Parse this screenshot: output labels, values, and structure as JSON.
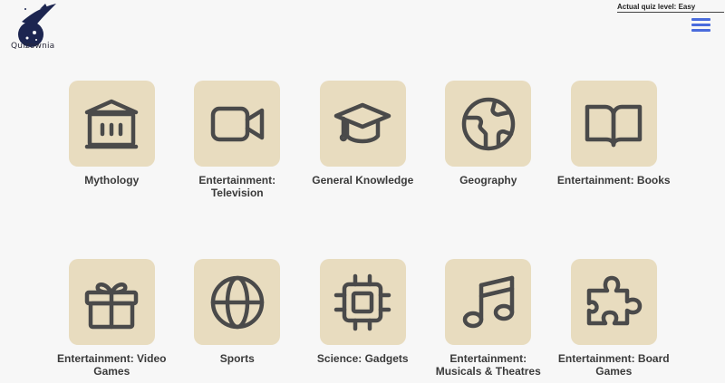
{
  "app": {
    "logo_text": "Quizownia"
  },
  "header": {
    "quiz_level": "Actual quiz level: Easy"
  },
  "categories": [
    {
      "label": "Mythology",
      "icon": "temple-icon"
    },
    {
      "label": "Entertainment: Television",
      "icon": "video-camera-icon"
    },
    {
      "label": "General Knowledge",
      "icon": "graduation-cap-icon"
    },
    {
      "label": "Geography",
      "icon": "earth-icon"
    },
    {
      "label": "Entertainment: Books",
      "icon": "book-icon"
    },
    {
      "label": "Entertainment: Video Games",
      "icon": "gift-icon"
    },
    {
      "label": "Sports",
      "icon": "globe-icon"
    },
    {
      "label": "Science: Gadgets",
      "icon": "chip-icon"
    },
    {
      "label": "Entertainment: Musicals & Theatres",
      "icon": "music-note-icon"
    },
    {
      "label": "Entertainment: Board Games",
      "icon": "puzzle-icon"
    }
  ],
  "colors": {
    "tile": "#e8dcbf",
    "icon": "#4a4a4a",
    "menu": "#4a6cdc"
  }
}
